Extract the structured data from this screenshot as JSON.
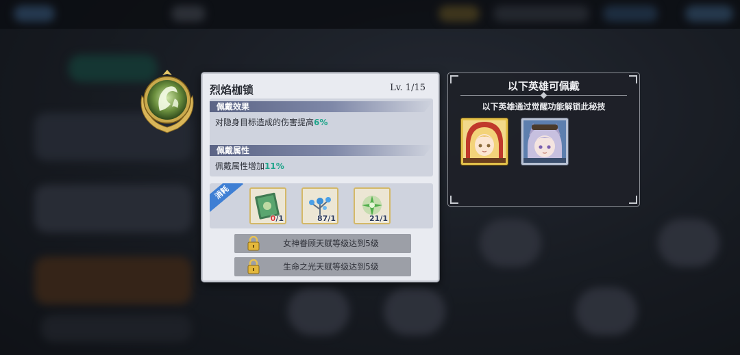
{
  "skill": {
    "name": "烈焰枷锁",
    "level": "Lv.  1/15",
    "effect_header": "佩戴效果",
    "effect_text": "对隐身目标造成的伤害提高",
    "effect_value": "6%",
    "attr_header": "佩戴属性",
    "attr_text": "佩戴属性增加",
    "attr_value": "11%",
    "cost_label": "消耗",
    "cost_items": [
      {
        "name": "green-book",
        "owned": "0",
        "required": "/1"
      },
      {
        "name": "blue-flower",
        "owned": "87",
        "required": "/1"
      },
      {
        "name": "green-leaf",
        "owned": "21",
        "required": "/1"
      }
    ],
    "requirements": [
      "女神眷顾天赋等级达到5级",
      "生命之光天赋等级达到5级"
    ]
  },
  "hero_panel": {
    "title": "以下英雄可佩戴",
    "subtitle": "以下英雄通过觉醒功能解锁此秘技",
    "heroes": [
      {
        "icon": "blonde-girl-red-hood-portrait",
        "frame": "gold"
      },
      {
        "icon": "silver-hair-cat-ear-portrait",
        "frame": "silver"
      }
    ]
  },
  "colors": {
    "highlight": "#1fa48a",
    "insufficient": "#d63a3a",
    "section_header": "#5b6485",
    "cost_tag": "#3f7fd4",
    "gold_frame": "#e3c14a"
  }
}
